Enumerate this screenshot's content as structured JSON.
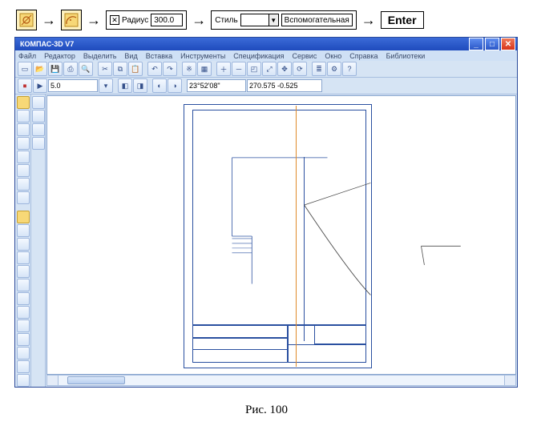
{
  "strip": {
    "radius_label": "Радиус",
    "radius_value": "300.0",
    "style_label": "Стиль",
    "style_value": "Вспомогательная",
    "enter": "Enter",
    "chk": "✕"
  },
  "app": {
    "title": "КОМПАС-3D V7",
    "menu": [
      "Файл",
      "Редактор",
      "Выделить",
      "Вид",
      "Вставка",
      "Инструменты",
      "Спецификация",
      "Сервис",
      "Окно",
      "Справка",
      "Библиотеки"
    ],
    "zoom": "5.0",
    "coords1": "23°52'08\"",
    "coords2": "270.575  -0.525",
    "win": {
      "min": "_",
      "max": "□",
      "close": "✕"
    }
  },
  "caption": "Рис. 100"
}
